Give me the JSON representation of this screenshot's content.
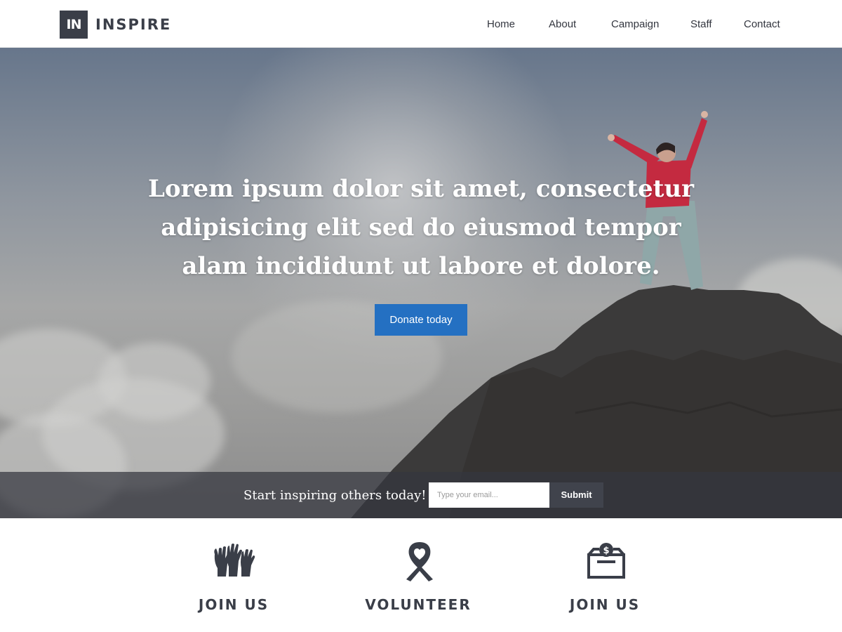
{
  "header": {
    "logo_mark": "IN",
    "logo_text": "INSPIRE",
    "nav": [
      "Home",
      "About",
      "Campaign",
      "Staff",
      "Contact"
    ]
  },
  "hero": {
    "title": "Lorem ipsum dolor sit amet, consectetur adipisicing elit sed do eiusmod tempor alam incididunt ut labore et dolore.",
    "button_label": "Donate today"
  },
  "signup": {
    "label": "Start inspiring others today!",
    "email_placeholder": "Type your email...",
    "email_value": "",
    "submit_label": "Submit"
  },
  "features": [
    {
      "icon": "raised-hands-icon",
      "label": "JOIN US"
    },
    {
      "icon": "ribbon-heart-icon",
      "label": "VOLUNTEER"
    },
    {
      "icon": "donation-box-icon",
      "label": "JOIN US"
    }
  ],
  "colors": {
    "accent": "#2470c2",
    "dark": "#3a3e48",
    "strip": "#34363e"
  }
}
